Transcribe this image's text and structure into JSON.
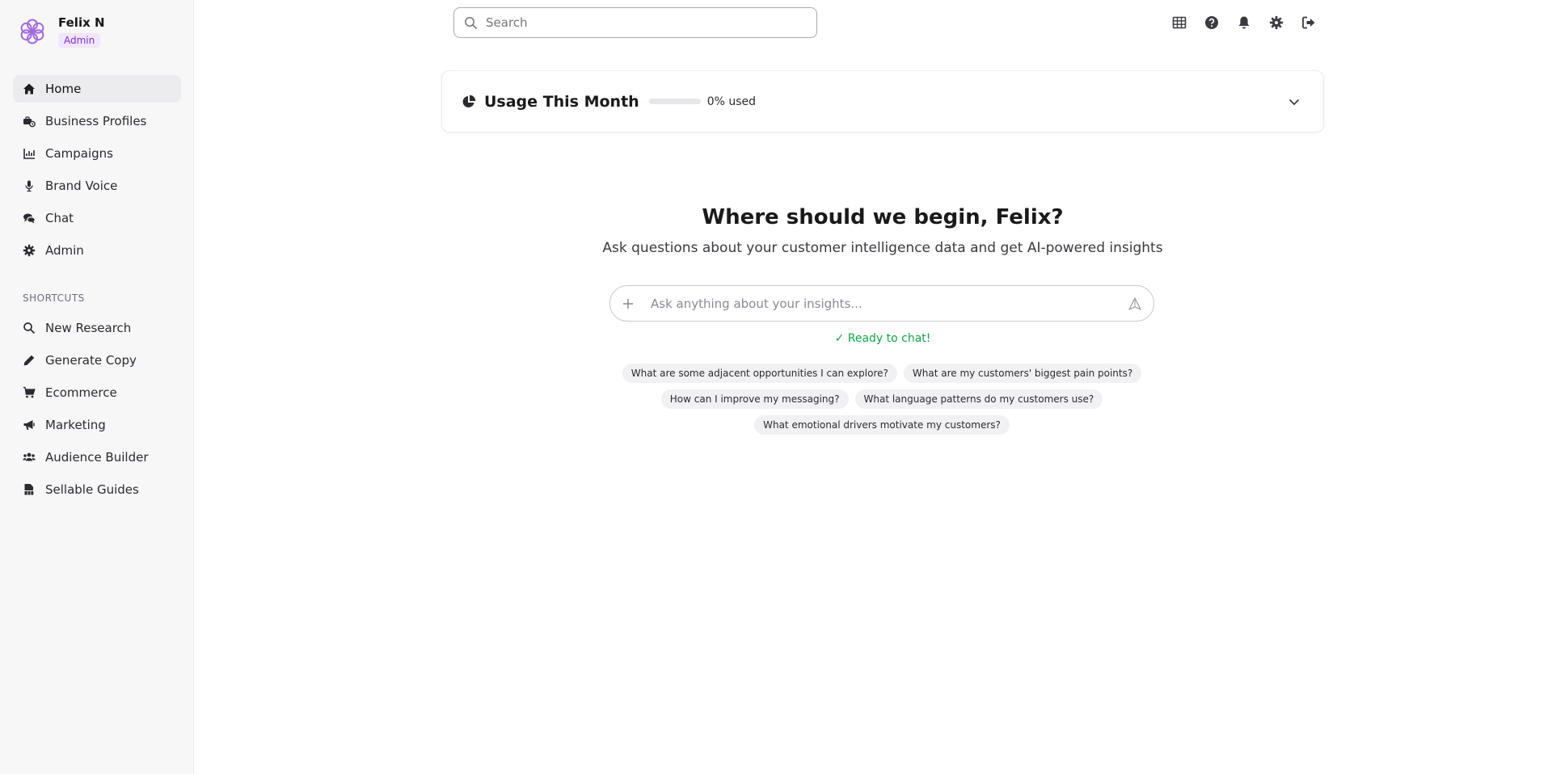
{
  "user": {
    "name": "Felix N",
    "role": "Admin"
  },
  "nav": [
    {
      "label": "Home",
      "icon": "home-icon",
      "active": true
    },
    {
      "label": "Business Profiles",
      "icon": "business-icon"
    },
    {
      "label": "Campaigns",
      "icon": "chart-icon"
    },
    {
      "label": "Brand Voice",
      "icon": "microphone-icon"
    },
    {
      "label": "Chat",
      "icon": "chat-icon"
    },
    {
      "label": "Admin",
      "icon": "gear-icon"
    }
  ],
  "shortcuts": {
    "label": "SHORTCUTS",
    "items": [
      {
        "label": "New Research",
        "icon": "search-icon"
      },
      {
        "label": "Generate Copy",
        "icon": "pencil-icon"
      },
      {
        "label": "Ecommerce",
        "icon": "cart-icon"
      },
      {
        "label": "Marketing",
        "icon": "megaphone-icon"
      },
      {
        "label": "Audience Builder",
        "icon": "users-icon"
      },
      {
        "label": "Sellable Guides",
        "icon": "pdf-icon"
      }
    ]
  },
  "search": {
    "placeholder": "Search",
    "value": ""
  },
  "top_icons": [
    "table-icon",
    "help-icon",
    "bell-icon",
    "gear-icon",
    "logout-icon"
  ],
  "usage": {
    "title": "Usage This Month",
    "percent_label": "0% used",
    "fraction_used": 0
  },
  "hero": {
    "title": "Where should we begin, Felix?",
    "subtitle": "Ask questions about your customer intelligence data and get AI-powered insights"
  },
  "chat": {
    "placeholder": "Ask anything about your insights...",
    "status": "✓ Ready to chat!"
  },
  "suggestions": [
    "What are some adjacent opportunities I can explore?",
    "What are my customers' biggest pain points?",
    "How can I improve my messaging?",
    "What language patterns do my customers use?",
    "What emotional drivers motivate my customers?"
  ],
  "colors": {
    "accent": "#7a2ed0",
    "success": "#16a34a",
    "sidebar_bg": "#f7f7f8"
  }
}
